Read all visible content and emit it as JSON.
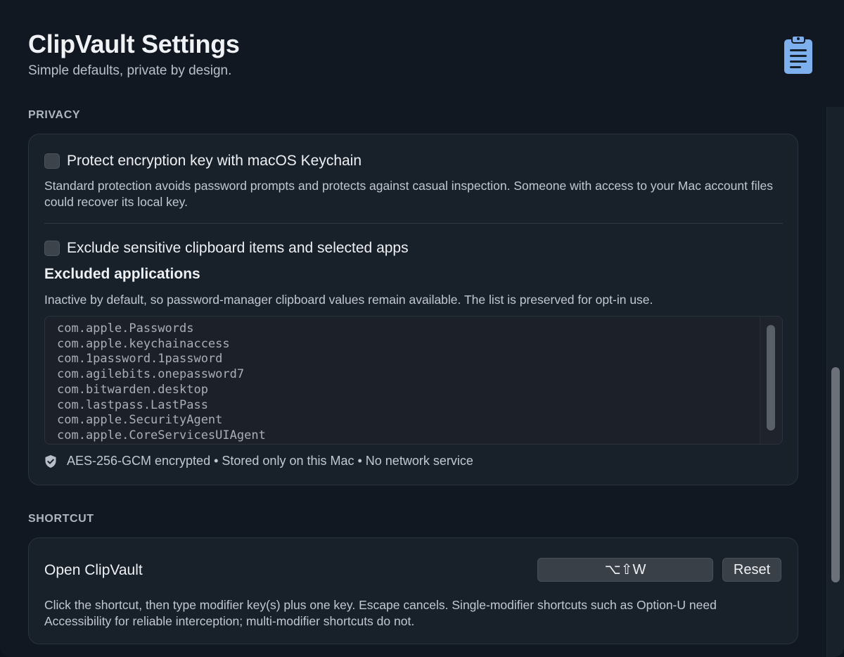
{
  "header": {
    "title": "ClipVault Settings",
    "subtitle": "Simple defaults, private by design.",
    "icon": "clipboard-icon",
    "icon_color": "#7fb0ee"
  },
  "privacy": {
    "section_label": "PRIVACY",
    "keychain": {
      "label": "Protect encryption key with macOS Keychain",
      "checked": false,
      "description": "Standard protection avoids password prompts and protects against casual inspection. Someone with access to your Mac account files could recover its local key."
    },
    "exclude": {
      "label": "Exclude sensitive clipboard items and selected apps",
      "checked": false
    },
    "excluded_apps": {
      "heading": "Excluded applications",
      "description": "Inactive by default, so password-manager clipboard values remain available. The list is preserved for opt-in use.",
      "items": [
        "com.apple.Passwords",
        "com.apple.keychainaccess",
        "com.1password.1password",
        "com.agilebits.onepassword7",
        "com.bitwarden.desktop",
        "com.lastpass.LastPass",
        "com.apple.SecurityAgent",
        "com.apple.CoreServicesUIAgent"
      ]
    },
    "status": "AES-256-GCM encrypted • Stored only on this Mac • No network service",
    "status_icon": "shield-check-icon"
  },
  "shortcut": {
    "section_label": "SHORTCUT",
    "title": "Open ClipVault",
    "keys": "⌥⇧W",
    "reset_label": "Reset",
    "description": "Click the shortcut, then type modifier key(s) plus one key. Escape cancels. Single-modifier shortcuts such as Option-U need Accessibility for reliable interception; multi-modifier shortcuts do not."
  }
}
